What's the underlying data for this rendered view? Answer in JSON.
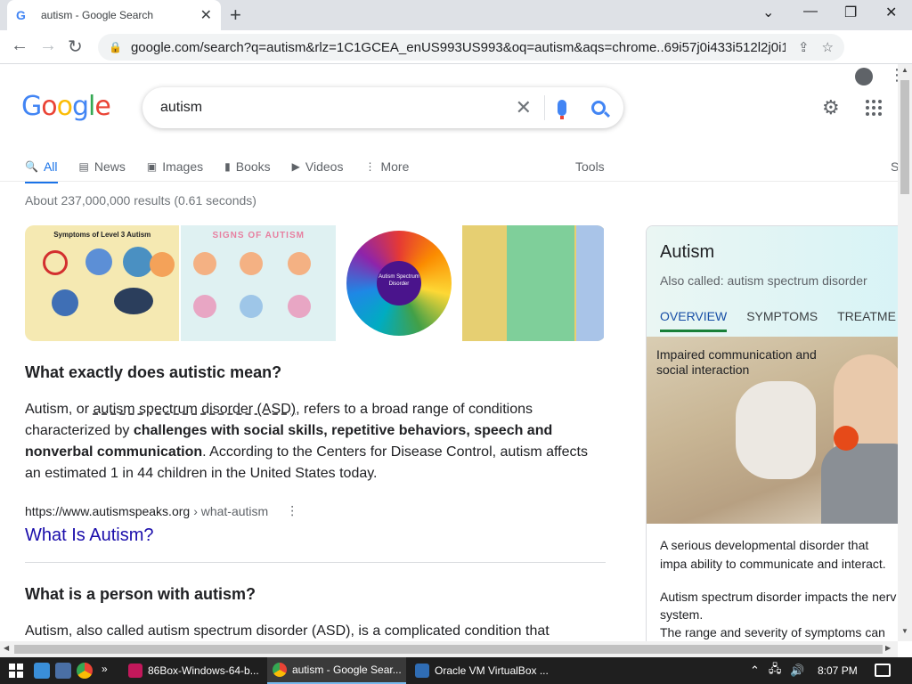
{
  "browser": {
    "tab_title": "autism - Google Search",
    "new_tab_glyph": "+",
    "url": "google.com/search?q=autism&rlz=1C1GCEA_enUS993US993&oq=autism&aqs=chrome..69i57j0i433i512l2j0i131i433i..."
  },
  "search": {
    "query": "autism",
    "tabs": [
      {
        "label": "All",
        "icon": "search-icon"
      },
      {
        "label": "News",
        "icon": "news-icon"
      },
      {
        "label": "Images",
        "icon": "image-icon"
      },
      {
        "label": "Books",
        "icon": "book-icon"
      },
      {
        "label": "Videos",
        "icon": "video-icon"
      },
      {
        "label": "More",
        "icon": "more-vert-icon"
      }
    ],
    "tools_label": "Tools",
    "cut_label": "S",
    "stats": "About 237,000,000 results (0.61 seconds)"
  },
  "images": {
    "tile1_title": "Symptoms of Level 3 Autism",
    "tile2_title": "SIGNS OF AUTISM",
    "tile3_center": "Autism Spectrum Disorder"
  },
  "snippet": {
    "question": "What exactly does autistic mean?",
    "text_a": "Autism, or ",
    "text_link": "autism spectrum disorder (ASD)",
    "text_b": ", refers to a broad range of conditions characterized by ",
    "text_bold1": "challenges with social skills, repetitive behaviors, speech and nonverbal communication",
    "text_c": ". According to the Centers for Disease Control, autism affects an estimated 1 in 44 children in the United States today.",
    "cite_domain": "https://www.autismspeaks.org",
    "cite_path": "› what-autism",
    "link_title": "What Is Autism?"
  },
  "second": {
    "question": "What is a person with autism?",
    "text": "Autism, also called autism spectrum disorder (ASD), is a complicated condition that"
  },
  "knowledge_panel": {
    "title": "Autism",
    "subtitle": "Also called: autism spectrum disorder",
    "tabs": [
      "OVERVIEW",
      "SYMPTOMS",
      "TREATME"
    ],
    "image_caption": "Impaired communication and social interaction",
    "desc1": "A serious developmental disorder that impa ability to communicate and interact.",
    "desc2": "Autism spectrum disorder impacts the nerv system.",
    "desc3": "The range and severity of symptoms can va"
  },
  "taskbar": {
    "task1": "86Box-Windows-64-b...",
    "task2": "autism - Google Sear...",
    "task3": "Oracle VM VirtualBox ...",
    "time": "8:07 PM"
  },
  "colors": {
    "google_blue": "#4285f4",
    "google_red": "#ea4335",
    "google_yellow": "#fbbc05",
    "google_green": "#34a853",
    "link": "#1a0dab",
    "active_tab": "#1a73e8"
  }
}
